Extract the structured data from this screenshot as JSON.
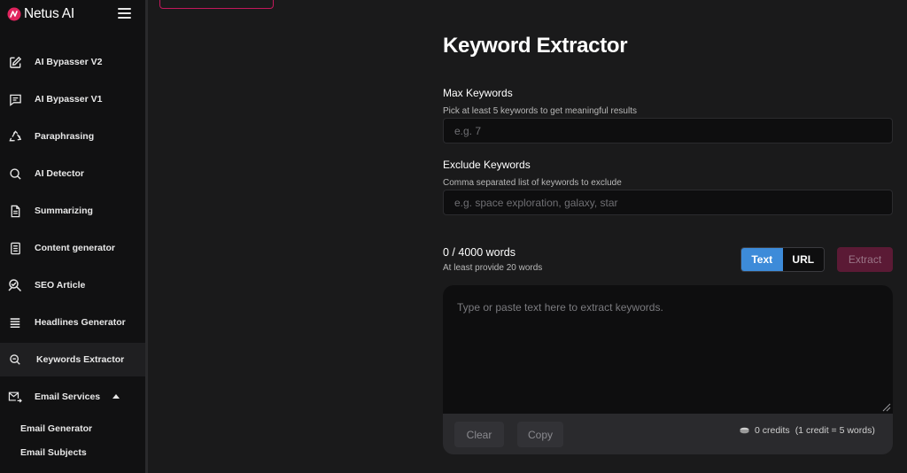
{
  "brand": {
    "name": "Netus AI",
    "logo_color": "#e0245e"
  },
  "sidebar": {
    "items": [
      {
        "label": "AI Bypasser V2",
        "icon": "pencil-square-icon"
      },
      {
        "label": "AI Bypasser V1",
        "icon": "chat-lines-icon"
      },
      {
        "label": "Paraphrasing",
        "icon": "recycle-icon"
      },
      {
        "label": "AI Detector",
        "icon": "search-icon"
      },
      {
        "label": "Summarizing",
        "icon": "document-icon"
      },
      {
        "label": "Content generator",
        "icon": "list-document-icon"
      },
      {
        "label": "SEO Article",
        "icon": "seo-search-icon"
      },
      {
        "label": "Headlines Generator",
        "icon": "lines-icon"
      },
      {
        "label": "Keywords Extractor",
        "icon": "zoom-search-icon",
        "active": true
      },
      {
        "label": "Email Services",
        "icon": "email-send-icon",
        "expanded": true
      }
    ],
    "sub_items": [
      {
        "label": "Email Generator"
      },
      {
        "label": "Email Subjects"
      }
    ]
  },
  "main": {
    "title": "Keyword Extractor",
    "max_keywords": {
      "label": "Max Keywords",
      "hint": "Pick at least 5 keywords to get meaningful results",
      "placeholder": "e.g. 7",
      "value": ""
    },
    "exclude_keywords": {
      "label": "Exclude Keywords",
      "hint": "Comma separated list of keywords to exclude",
      "placeholder": "e.g. space exploration, galaxy, star",
      "value": ""
    },
    "word_count": "0 / 4000 words",
    "word_hint": "At least provide 20 words",
    "modes": [
      {
        "label": "Text",
        "selected": true
      },
      {
        "label": "URL",
        "selected": false
      }
    ],
    "extract_label": "Extract",
    "editor": {
      "placeholder": "Type or paste text here to extract keywords.",
      "value": "",
      "clear_label": "Clear",
      "copy_label": "Copy",
      "credits": "0 credits",
      "credit_rate": "(1 credit = 5 words)"
    }
  },
  "colors": {
    "accent_blue": "#3d8bd9",
    "extract_disabled": "#5b1a35",
    "pill_border": "#c2185b"
  }
}
